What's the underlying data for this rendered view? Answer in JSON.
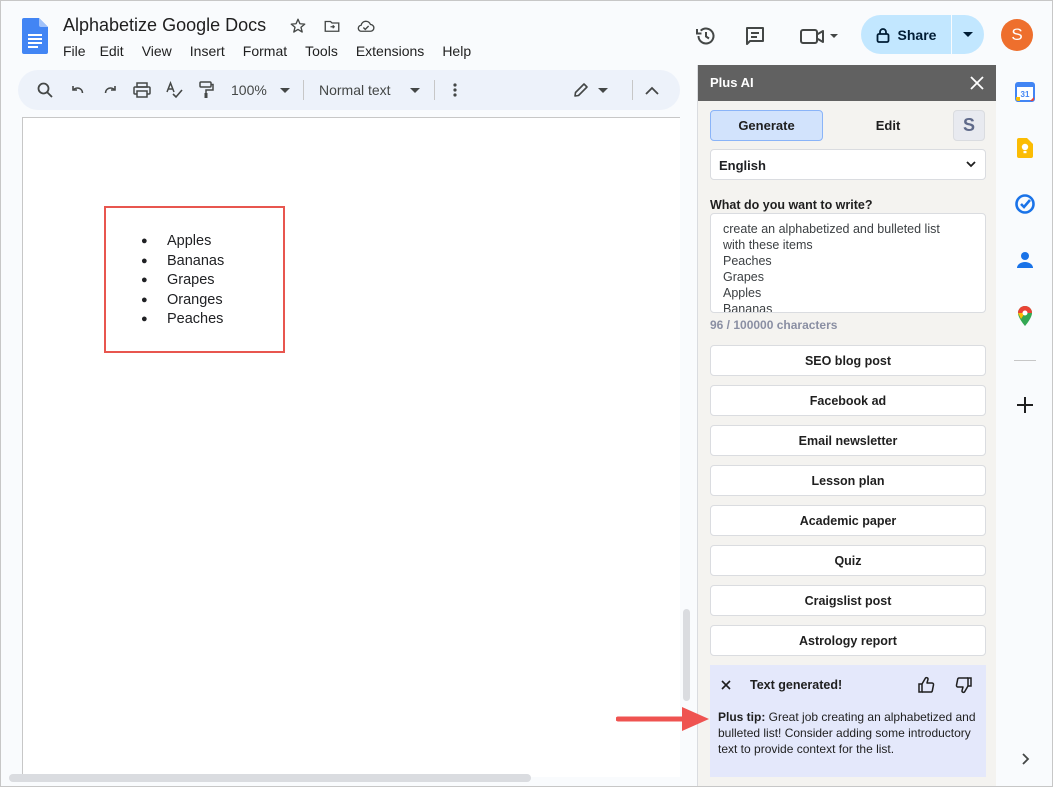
{
  "doc": {
    "title": "Alphabetize Google Docs",
    "menu": [
      "File",
      "Edit",
      "View",
      "Insert",
      "Format",
      "Tools",
      "Extensions",
      "Help"
    ],
    "share_label": "Share",
    "avatar_letter": "S",
    "list_items": [
      "Apples",
      "Bananas",
      "Grapes",
      "Oranges",
      "Peaches"
    ]
  },
  "toolbar": {
    "zoom": "100%",
    "style": "Normal text"
  },
  "panel": {
    "title": "Plus AI",
    "tab_generate": "Generate",
    "tab_edit": "Edit",
    "tab_s": "S",
    "language": "English",
    "prompt_label": "What do you want to write?",
    "prompt_text": "create an alphabetized and bulleted list\nwith these items\nPeaches\nGrapes\nApples\nBananas",
    "char_count": "96 / 100000 characters",
    "options": [
      "SEO blog post",
      "Facebook ad",
      "Email newsletter",
      "Lesson plan",
      "Academic paper",
      "Quiz",
      "Craigslist post",
      "Astrology report"
    ],
    "notice_title": "Text generated!",
    "tip_label": "Plus tip:",
    "tip_text": " Great job creating an alphabetized and bulleted list! Consider adding some introductory text to provide context for the list."
  },
  "colors": {
    "accent": "#c2e7ff",
    "highlight": "#e8564f",
    "avatar": "#ee6f2d",
    "arrow": "#ef5350"
  }
}
